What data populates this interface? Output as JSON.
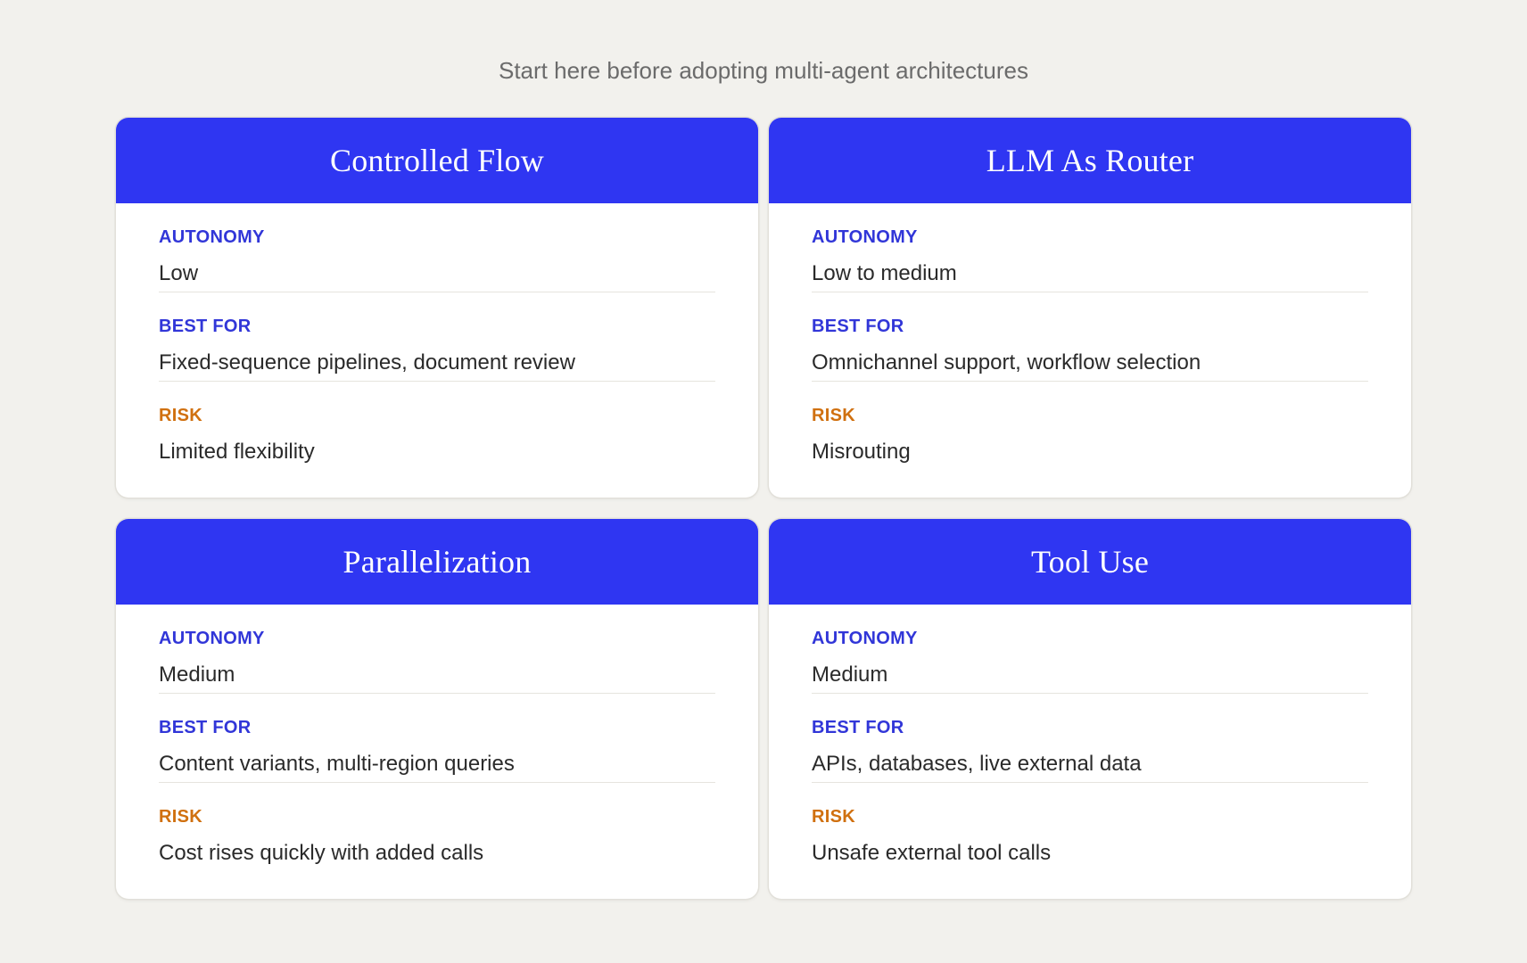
{
  "subtitle": "Start here before adopting multi-agent architectures",
  "colors": {
    "background": "#f2f1ed",
    "header": "#2f36f2",
    "label": "#3136d8",
    "risk_label": "#d0700f"
  },
  "cards": [
    {
      "title": "Controlled Flow",
      "rows": [
        {
          "label": "AUTONOMY",
          "value": "Low"
        },
        {
          "label": "BEST FOR",
          "value": "Fixed-sequence pipelines, document review"
        },
        {
          "label": "RISK",
          "value": "Limited flexibility"
        }
      ]
    },
    {
      "title": "LLM As Router",
      "rows": [
        {
          "label": "AUTONOMY",
          "value": "Low to medium"
        },
        {
          "label": "BEST FOR",
          "value": "Omnichannel support, workflow selection"
        },
        {
          "label": "RISK",
          "value": "Misrouting"
        }
      ]
    },
    {
      "title": "Parallelization",
      "rows": [
        {
          "label": "AUTONOMY",
          "value": "Medium"
        },
        {
          "label": "BEST FOR",
          "value": "Content variants, multi-region queries"
        },
        {
          "label": "RISK",
          "value": "Cost rises quickly with added calls"
        }
      ]
    },
    {
      "title": "Tool Use",
      "rows": [
        {
          "label": "AUTONOMY",
          "value": "Medium"
        },
        {
          "label": "BEST FOR",
          "value": "APIs, databases, live external data"
        },
        {
          "label": "RISK",
          "value": "Unsafe external tool calls"
        }
      ]
    }
  ]
}
